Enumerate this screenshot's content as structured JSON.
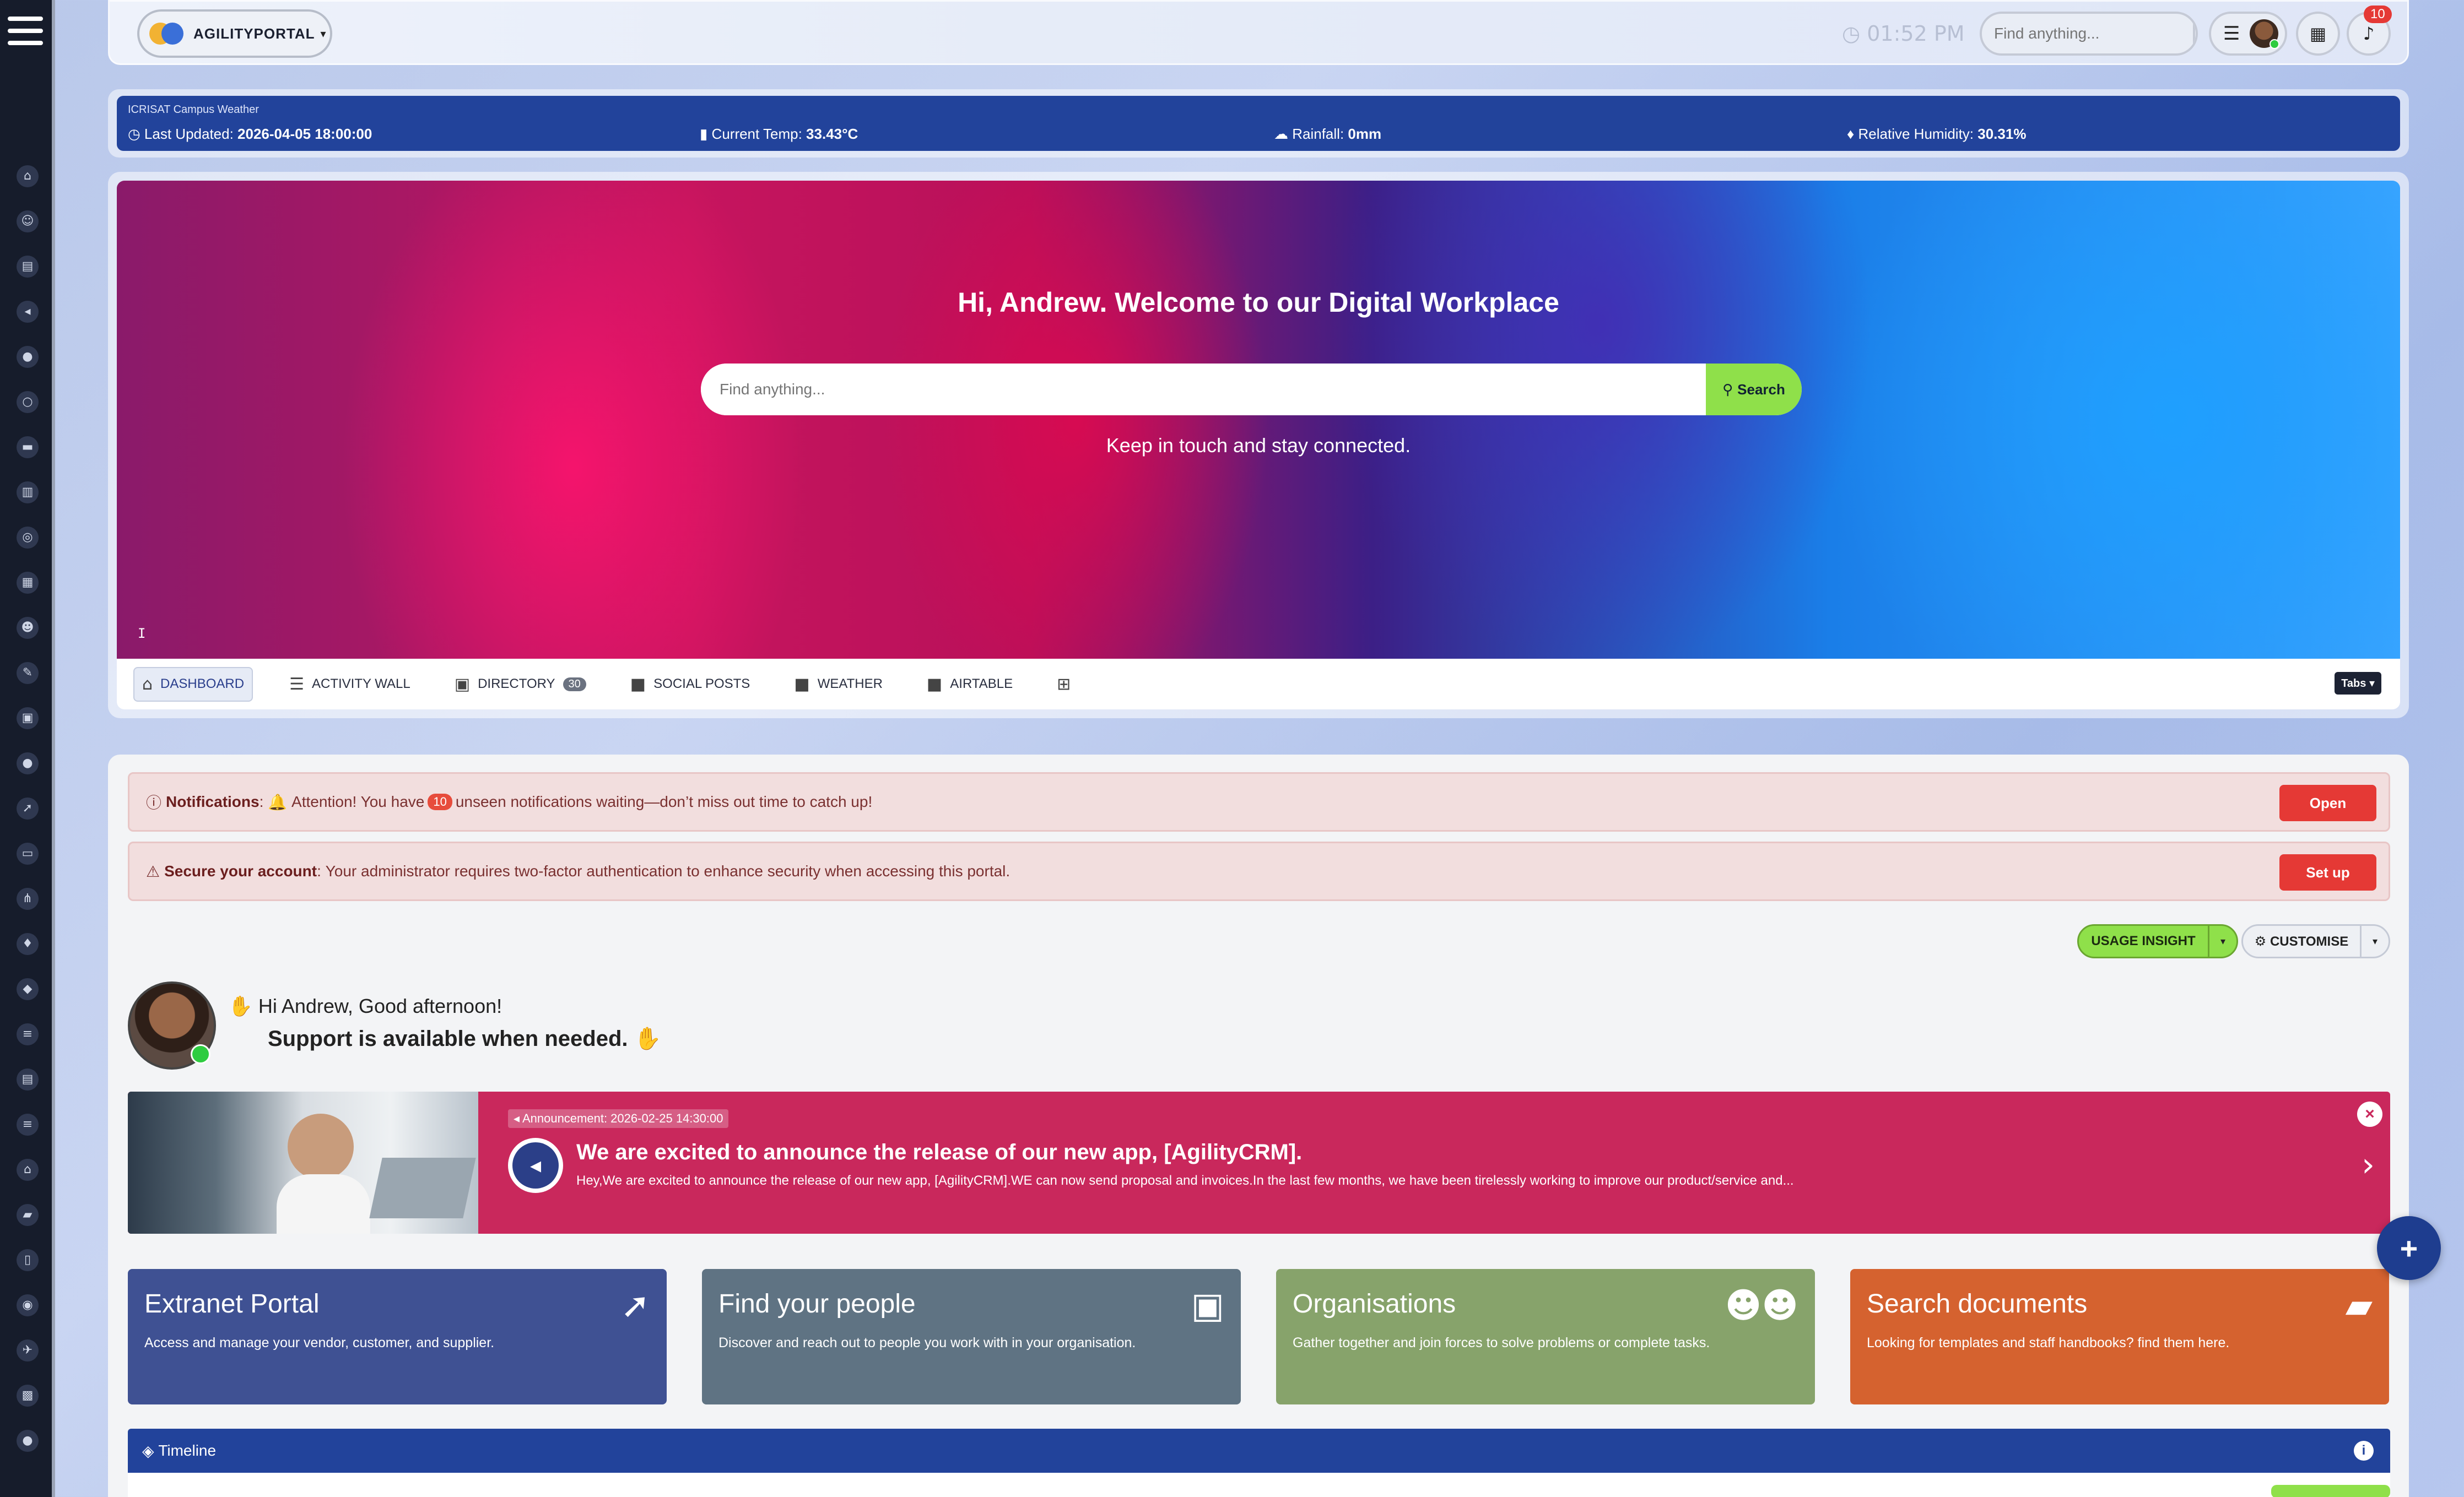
{
  "topbar": {
    "brand_name": "AGILITYPORTAL",
    "clock": "01:52 PM",
    "search_placeholder": "Find anything...",
    "notifications_count": "10"
  },
  "weather": {
    "title": "ICRISAT Campus Weather",
    "last_updated_label": "Last Updated:",
    "last_updated_value": "2026-04-05 18:00:00",
    "temp_label": "Current Temp:",
    "temp_value": "33.43°C",
    "rain_label": "Rainfall:",
    "rain_value": "0mm",
    "humidity_label": "Relative Humidity:",
    "humidity_value": "30.31%"
  },
  "hero": {
    "title": "Hi, Andrew. Welcome to our Digital Workplace",
    "search_placeholder": "Find anything...",
    "search_button": "Search",
    "tagline": "Keep in touch and stay connected."
  },
  "tabs": [
    {
      "label": "DASHBOARD",
      "icon": "home-icon"
    },
    {
      "label": "ACTIVITY WALL",
      "icon": "list-icon"
    },
    {
      "label": "DIRECTORY",
      "icon": "contact-icon",
      "count": "30"
    },
    {
      "label": "SOCIAL POSTS",
      "icon": "square-icon"
    },
    {
      "label": "WEATHER",
      "icon": "square-icon"
    },
    {
      "label": "AIRTABLE",
      "icon": "square-icon"
    }
  ],
  "tabs_dropdown": "Tabs",
  "alerts": {
    "notifications": {
      "title": "Notifications",
      "before": "Attention! You have",
      "count": "10",
      "after": "unseen notifications waiting—don’t miss out time to catch up!",
      "button": "Open"
    },
    "security": {
      "title": "Secure your account",
      "text": "Your administrator requires two-factor authentication to enhance security when accessing this portal.",
      "button": "Set up"
    }
  },
  "actions": {
    "usage_insight": "USAGE INSIGHT",
    "customise": "CUSTOMISE"
  },
  "greeting": {
    "line1": "Hi Andrew, Good afternoon!",
    "line2": "Support is available when needed."
  },
  "announcement": {
    "badge": "Announcement: 2026-02-25 14:30:00",
    "title": "We are excited to announce the release of our new app, [AgilityCRM].",
    "text": "Hey,We are excited to announce the release of our new app, [AgilityCRM].WE can now send proposal and invoices.In the last few months, we have been tirelessly working to improve our product/service and..."
  },
  "cards": [
    {
      "title": "Extranet Portal",
      "desc": "Access and manage your vendor, customer, and supplier.",
      "color": "#3f5193",
      "icon": "rocket-icon"
    },
    {
      "title": "Find your people",
      "desc": "Discover and reach out to people you work with in your organisation.",
      "color": "#5f7383",
      "icon": "contact-card-icon"
    },
    {
      "title": "Organisations",
      "desc": "Gather together and join forces to solve problems or complete tasks.",
      "color": "#87a36b",
      "icon": "users-icon"
    },
    {
      "title": "Search documents",
      "desc": "Looking for templates and staff handbooks? find them here.",
      "color": "#d5622f",
      "icon": "folder-plus-icon"
    }
  ],
  "timeline": {
    "title": "Timeline"
  },
  "colors": {
    "sidebar": "#161c2b",
    "weather_bar": "#22439b",
    "accent_green": "#8fe04a",
    "alert_red": "#e53935",
    "announcement": "#c9285c"
  }
}
